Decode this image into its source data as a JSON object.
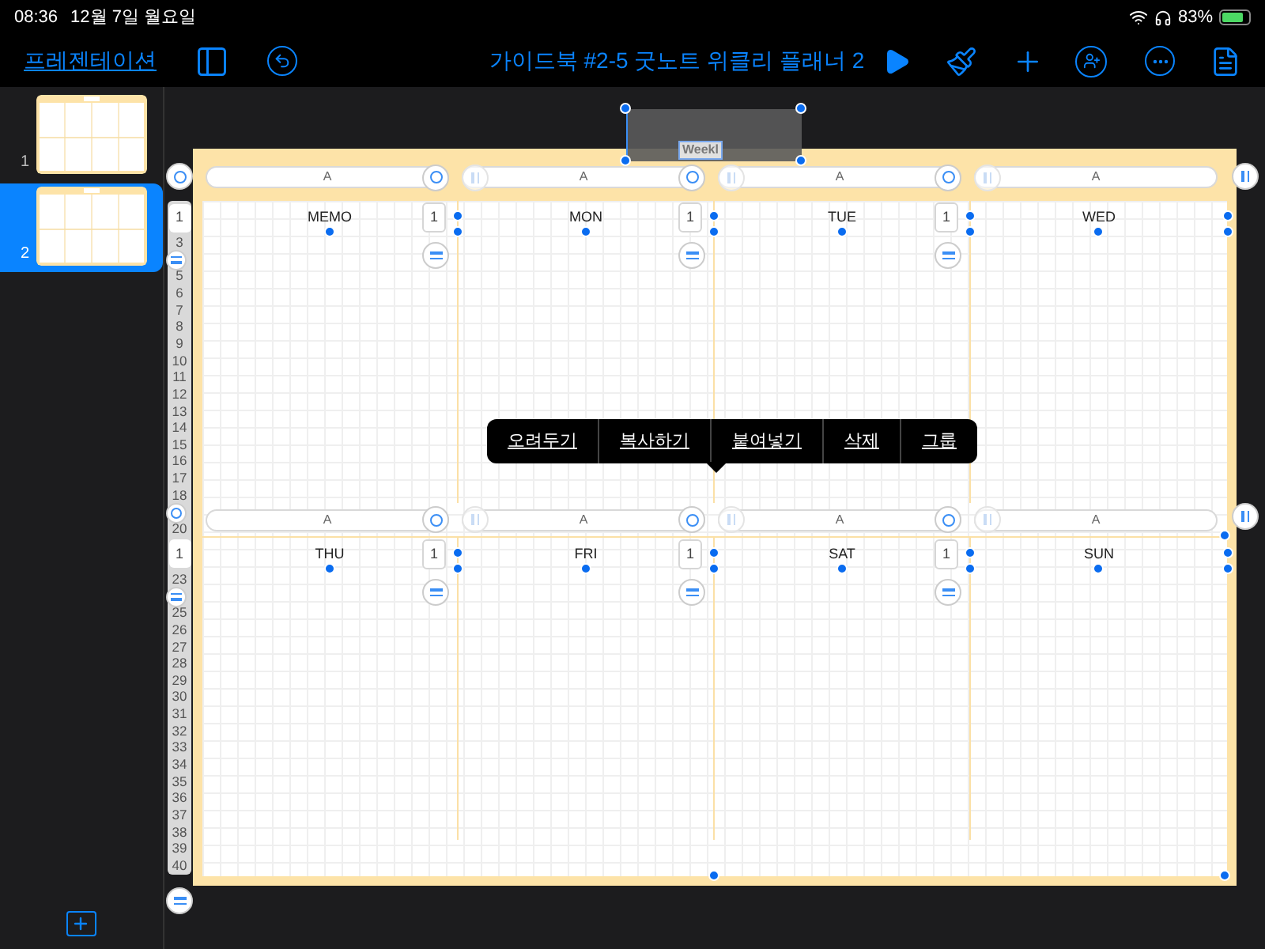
{
  "status_bar": {
    "time": "08:36",
    "date": "12월 7일 월요일",
    "battery": "83%"
  },
  "toolbar": {
    "back_link": "프레젠테이션",
    "title": "가이드북 #2-5 굿노트 위클리 플래너 2"
  },
  "slides": [
    {
      "number": "1",
      "selected": false
    },
    {
      "number": "2",
      "selected": true
    }
  ],
  "canvas": {
    "title_object": "Weekl",
    "row_numbers": [
      {
        "label": "1",
        "kind": "box"
      },
      {
        "label": "3",
        "kind": "number"
      },
      {
        "kind": "eq_handle"
      },
      {
        "label": "5",
        "kind": "number"
      },
      {
        "label": "6",
        "kind": "number"
      },
      {
        "label": "7",
        "kind": "number"
      },
      {
        "label": "8",
        "kind": "number"
      },
      {
        "label": "9",
        "kind": "number"
      },
      {
        "label": "10",
        "kind": "number"
      },
      {
        "label": "11",
        "kind": "number"
      },
      {
        "label": "12",
        "kind": "number"
      },
      {
        "label": "13",
        "kind": "number"
      },
      {
        "label": "14",
        "kind": "number"
      },
      {
        "label": "15",
        "kind": "number"
      },
      {
        "label": "16",
        "kind": "number"
      },
      {
        "label": "17",
        "kind": "number"
      },
      {
        "label": "18",
        "kind": "number"
      },
      {
        "kind": "ring_handle"
      },
      {
        "label": "20",
        "kind": "number"
      },
      {
        "label": "1",
        "kind": "box"
      },
      {
        "label": "23",
        "kind": "number"
      },
      {
        "kind": "eq_handle"
      },
      {
        "label": "25",
        "kind": "number"
      },
      {
        "label": "26",
        "kind": "number"
      },
      {
        "label": "27",
        "kind": "number"
      },
      {
        "label": "28",
        "kind": "number"
      },
      {
        "label": "29",
        "kind": "number"
      },
      {
        "label": "30",
        "kind": "number"
      },
      {
        "label": "31",
        "kind": "number"
      },
      {
        "label": "32",
        "kind": "number"
      },
      {
        "label": "33",
        "kind": "number"
      },
      {
        "label": "34",
        "kind": "number"
      },
      {
        "label": "35",
        "kind": "number"
      },
      {
        "label": "36",
        "kind": "number"
      },
      {
        "label": "37",
        "kind": "number"
      },
      {
        "label": "38",
        "kind": "number"
      },
      {
        "label": "39",
        "kind": "number"
      },
      {
        "label": "40",
        "kind": "number"
      }
    ],
    "sections": [
      {
        "bars": [
          "A",
          "A",
          "A",
          "A"
        ],
        "columns": [
          {
            "day": "MEMO",
            "count": "1"
          },
          {
            "day": "MON",
            "count": "1"
          },
          {
            "day": "TUE",
            "count": "1"
          },
          {
            "day": "WED"
          }
        ]
      },
      {
        "bars": [
          "A",
          "A",
          "A",
          "A"
        ],
        "columns": [
          {
            "day": "THU",
            "count": "1"
          },
          {
            "day": "FRI",
            "count": "1"
          },
          {
            "day": "SAT",
            "count": "1"
          },
          {
            "day": "SUN"
          }
        ]
      }
    ]
  },
  "context_menu": [
    "오려두기",
    "복사하기",
    "붙여넣기",
    "삭제",
    "그룹"
  ]
}
